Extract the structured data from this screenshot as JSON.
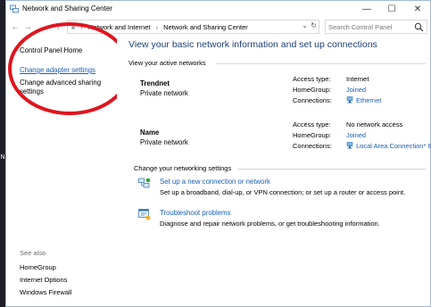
{
  "window": {
    "title": "Network and Sharing Center"
  },
  "titlebar": {
    "minimize_glyph": "—",
    "maximize_glyph": "☐",
    "close_glyph": "✕"
  },
  "address": {
    "back_glyph": "←",
    "forward_glyph": "→",
    "up_glyph": "↑",
    "crumb_root_glyph": "«",
    "crumbs": [
      "Network and Internet",
      "Network and Sharing Center"
    ],
    "separator": "›",
    "dropdown_glyph": "⌄",
    "refresh_glyph": "↻"
  },
  "search": {
    "placeholder": "Search Control Panel"
  },
  "sidebar": {
    "home": "Control Panel Home",
    "links": [
      "Change adapter settings",
      "Change advanced sharing settings"
    ],
    "see_also_label": "See also",
    "see_also": [
      "HomeGroup",
      "Internet Options",
      "Windows Firewall"
    ]
  },
  "main": {
    "heading": "View your basic network information and set up connections",
    "active_networks_label": "View your active networks",
    "networks": [
      {
        "name": "Trendnet",
        "type": "Private network",
        "access_label": "Access type:",
        "access_value": "Internet",
        "homegroup_label": "HomeGroup:",
        "homegroup_value": "Joined",
        "connections_label": "Connections:",
        "connections_value": "Ethernet"
      },
      {
        "name": "Name",
        "type": "Private network",
        "access_label": "Access type:",
        "access_value": "No network access",
        "homegroup_label": "HomeGroup:",
        "homegroup_value": "Joined",
        "connections_label": "Connections:",
        "connections_value": "Local Area Connection* 6"
      }
    ],
    "change_settings_label": "Change your networking settings",
    "tasks": [
      {
        "title": "Set up a new connection or network",
        "description": "Set up a broadband, dial-up, or VPN connection; or set up a router or access point."
      },
      {
        "title": "Troubleshoot problems",
        "description": "Diagnose and repair network problems, or get troubleshooting information."
      }
    ]
  },
  "colors": {
    "link": "#1a5fb4",
    "heading": "#1e3f78",
    "annotation": "#e0141e"
  },
  "annotation": {
    "shape": "red-ellipse",
    "target": "Change adapter settings"
  }
}
